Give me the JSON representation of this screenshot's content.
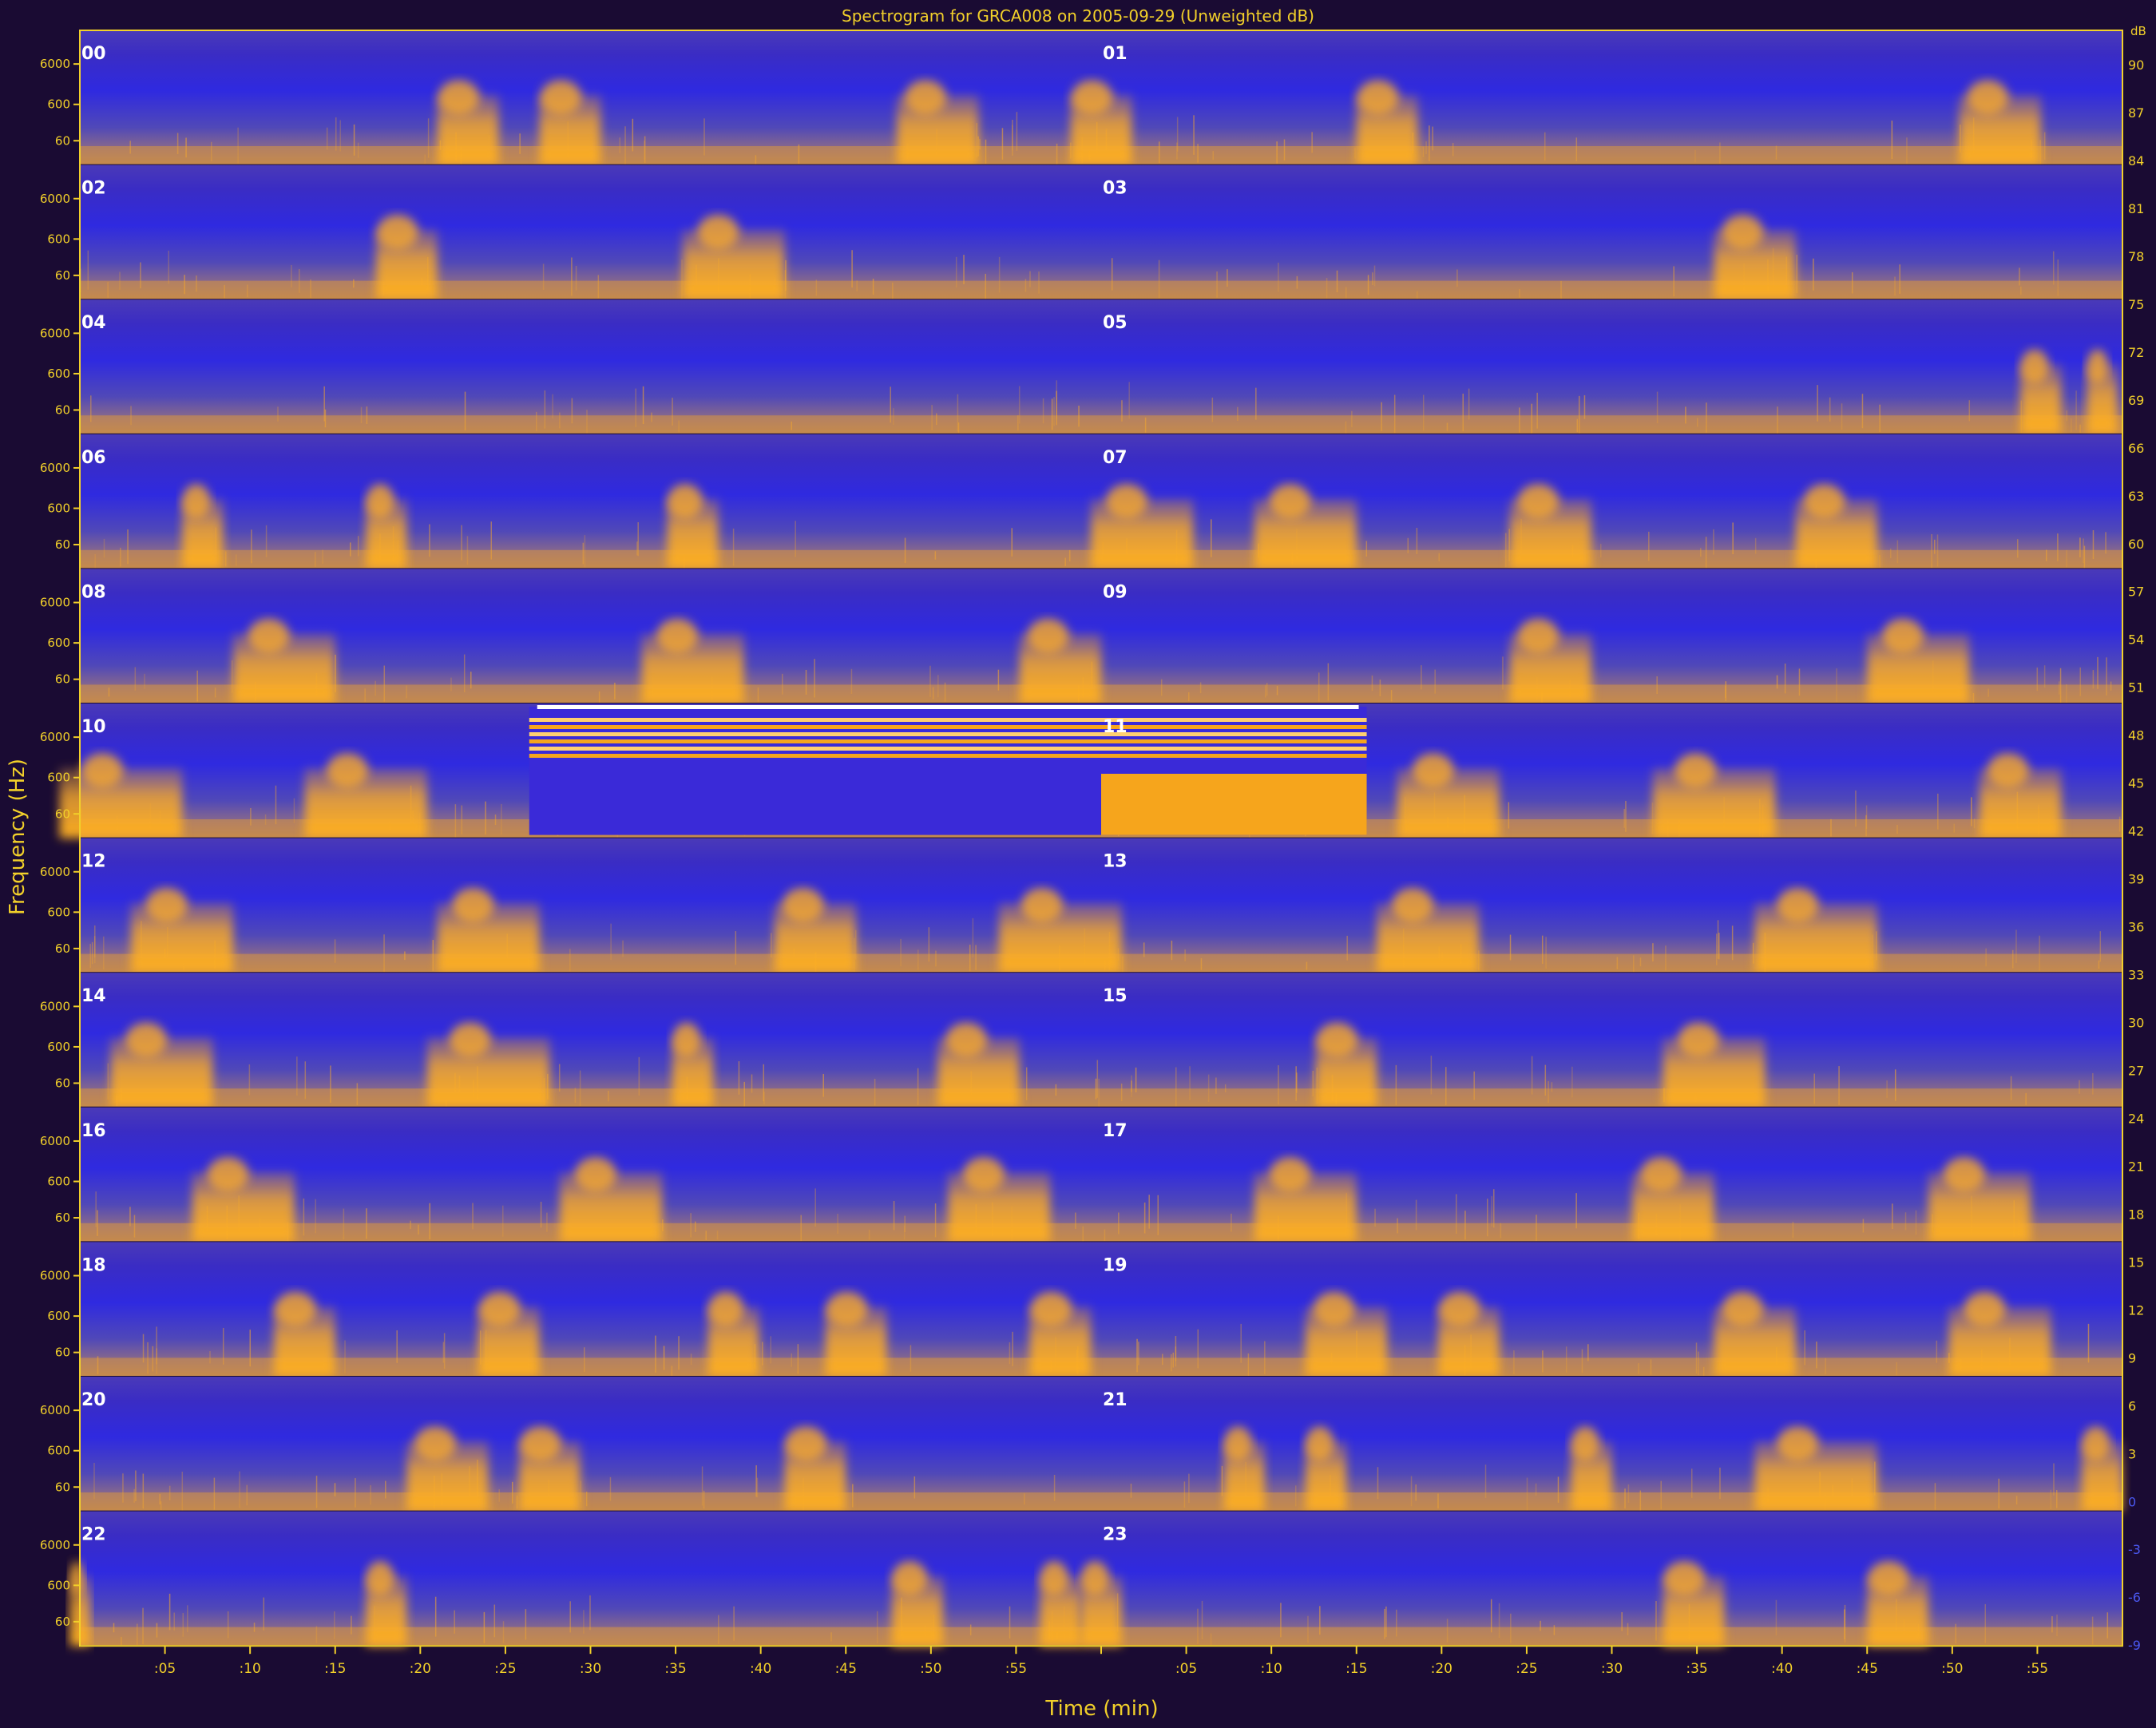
{
  "chart_data": {
    "type": "heatmap",
    "title": "Spectrogram for GRCA008 on 2005-09-29 (Unweighted dB)",
    "xlabel": "Time (min)",
    "ylabel": "Frequency (Hz)",
    "x_tick_labels": [
      ":05",
      ":10",
      ":15",
      ":20",
      ":25",
      ":30",
      ":35",
      ":40",
      ":45",
      ":50",
      ":55",
      "",
      ":05",
      ":10",
      ":15",
      ":20",
      ":25",
      ":30",
      ":35",
      ":40",
      ":45",
      ":50",
      ":55"
    ],
    "y_tick_labels": [
      "6000",
      "600",
      "60"
    ],
    "hour_labels": [
      "00",
      "01",
      "02",
      "03",
      "04",
      "05",
      "06",
      "07",
      "08",
      "09",
      "10",
      "11",
      "12",
      "13",
      "14",
      "15",
      "16",
      "17",
      "18",
      "19",
      "20",
      "21",
      "22",
      "23"
    ],
    "colorbar_label": "dB",
    "colorbar_ticks": [
      90,
      87,
      84,
      81,
      78,
      75,
      72,
      69,
      66,
      63,
      60,
      57,
      54,
      51,
      48,
      45,
      42,
      39,
      36,
      33,
      30,
      27,
      24,
      21,
      18,
      15,
      12,
      9,
      6,
      3,
      0,
      -3,
      -6,
      -9
    ],
    "colors": {
      "background": "#1a0b33",
      "quiet": "#3a2ad8",
      "mid": "#6a58b0",
      "loud": "#f6a51c",
      "text": "#f2d02a",
      "hour_label": "#ffffff",
      "positive_ticks": "#f2d02a",
      "negative_ticks": "#4a58f0"
    },
    "grid": false,
    "layout": "12 rows x 2 hours per row",
    "rows": [
      {
        "hours": [
          "00",
          "01"
        ],
        "loud_events": [
          [
            0.19,
            0.03
          ],
          [
            0.24,
            0.03
          ],
          [
            0.42,
            0.04
          ],
          [
            0.5,
            0.03
          ],
          [
            0.64,
            0.03
          ],
          [
            0.94,
            0.04
          ]
        ]
      },
      {
        "hours": [
          "02",
          "03"
        ],
        "loud_events": [
          [
            0.16,
            0.03
          ],
          [
            0.32,
            0.05
          ],
          [
            0.82,
            0.04
          ]
        ]
      },
      {
        "hours": [
          "04",
          "05"
        ],
        "loud_events": [
          [
            0.96,
            0.02
          ],
          [
            0.99,
            0.015
          ]
        ]
      },
      {
        "hours": [
          "06",
          "07"
        ],
        "loud_events": [
          [
            0.06,
            0.02
          ],
          [
            0.15,
            0.02
          ],
          [
            0.3,
            0.025
          ],
          [
            0.52,
            0.05
          ],
          [
            0.6,
            0.05
          ],
          [
            0.72,
            0.04
          ],
          [
            0.86,
            0.04
          ]
        ]
      },
      {
        "hours": [
          "08",
          "09"
        ],
        "loud_events": [
          [
            0.1,
            0.05
          ],
          [
            0.3,
            0.05
          ],
          [
            0.48,
            0.04
          ],
          [
            0.72,
            0.04
          ],
          [
            0.9,
            0.05
          ]
        ]
      },
      {
        "hours": [
          "10",
          "11"
        ],
        "loud_events": [
          [
            0.02,
            0.06
          ],
          [
            0.14,
            0.06
          ],
          [
            0.67,
            0.05
          ],
          [
            0.8,
            0.06
          ],
          [
            0.95,
            0.04
          ]
        ],
        "anomaly_start": 0.22,
        "anomaly_end": 0.63
      },
      {
        "hours": [
          "12",
          "13"
        ],
        "loud_events": [
          [
            0.05,
            0.05
          ],
          [
            0.2,
            0.05
          ],
          [
            0.36,
            0.04
          ],
          [
            0.48,
            0.06
          ],
          [
            0.66,
            0.05
          ],
          [
            0.85,
            0.06
          ]
        ]
      },
      {
        "hours": [
          "14",
          "15"
        ],
        "loud_events": [
          [
            0.04,
            0.05
          ],
          [
            0.2,
            0.06
          ],
          [
            0.3,
            0.02
          ],
          [
            0.44,
            0.04
          ],
          [
            0.62,
            0.03
          ],
          [
            0.8,
            0.05
          ]
        ]
      },
      {
        "hours": [
          "16",
          "17"
        ],
        "loud_events": [
          [
            0.08,
            0.05
          ],
          [
            0.26,
            0.05
          ],
          [
            0.45,
            0.05
          ],
          [
            0.6,
            0.05
          ],
          [
            0.78,
            0.04
          ],
          [
            0.93,
            0.05
          ]
        ]
      },
      {
        "hours": [
          "18",
          "19"
        ],
        "loud_events": [
          [
            0.11,
            0.03
          ],
          [
            0.21,
            0.03
          ],
          [
            0.32,
            0.025
          ],
          [
            0.38,
            0.03
          ],
          [
            0.48,
            0.03
          ],
          [
            0.62,
            0.04
          ],
          [
            0.68,
            0.03
          ],
          [
            0.82,
            0.04
          ],
          [
            0.94,
            0.05
          ]
        ]
      },
      {
        "hours": [
          "20",
          "21"
        ],
        "loud_events": [
          [
            0.18,
            0.04
          ],
          [
            0.23,
            0.03
          ],
          [
            0.36,
            0.03
          ],
          [
            0.57,
            0.02
          ],
          [
            0.61,
            0.02
          ],
          [
            0.74,
            0.02
          ],
          [
            0.85,
            0.06
          ],
          [
            0.99,
            0.02
          ]
        ]
      },
      {
        "hours": [
          "22",
          "23"
        ],
        "loud_events": [
          [
            0.0,
            0.01
          ],
          [
            0.15,
            0.02
          ],
          [
            0.41,
            0.025
          ],
          [
            0.48,
            0.02
          ],
          [
            0.5,
            0.02
          ],
          [
            0.79,
            0.03
          ],
          [
            0.89,
            0.03
          ]
        ]
      }
    ]
  }
}
